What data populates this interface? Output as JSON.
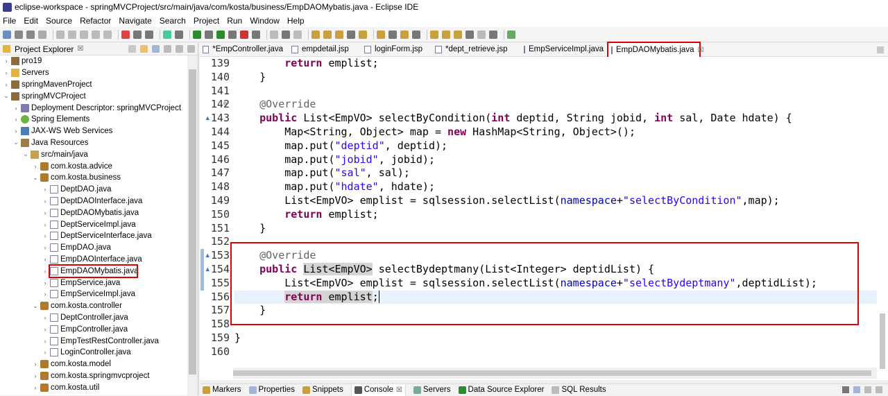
{
  "window": {
    "title": "eclipse-workspace - springMVCProject/src/main/java/com/kosta/business/EmpDAOMybatis.java - Eclipse IDE"
  },
  "menu": [
    "File",
    "Edit",
    "Source",
    "Refactor",
    "Navigate",
    "Search",
    "Project",
    "Run",
    "Window",
    "Help"
  ],
  "explorer": {
    "title": "Project Explorer",
    "close_glyph": "☒",
    "tree": [
      {
        "label": "pro19",
        "indent": 0,
        "chev": "›",
        "icon": "project"
      },
      {
        "label": "Servers",
        "indent": 0,
        "chev": "›",
        "icon": "folder"
      },
      {
        "label": "springMavenProject",
        "indent": 0,
        "chev": "›",
        "icon": "project"
      },
      {
        "label": "springMVCProject",
        "indent": 0,
        "chev": "⌄",
        "icon": "project"
      },
      {
        "label": "Deployment Descriptor: springMVCProject",
        "indent": 1,
        "chev": "›",
        "icon": "desc"
      },
      {
        "label": "Spring Elements",
        "indent": 1,
        "chev": "›",
        "icon": "spring"
      },
      {
        "label": "JAX-WS Web Services",
        "indent": 1,
        "chev": "›",
        "icon": "ws"
      },
      {
        "label": "Java Resources",
        "indent": 1,
        "chev": "⌄",
        "icon": "jres"
      },
      {
        "label": "src/main/java",
        "indent": 2,
        "chev": "⌄",
        "icon": "src"
      },
      {
        "label": "com.kosta.advice",
        "indent": 3,
        "chev": "›",
        "icon": "pkg"
      },
      {
        "label": "com.kosta.business",
        "indent": 3,
        "chev": "⌄",
        "icon": "pkg"
      },
      {
        "label": "DeptDAO.java",
        "indent": 4,
        "chev": "›",
        "icon": "jfile"
      },
      {
        "label": "DeptDAOInterface.java",
        "indent": 4,
        "chev": "›",
        "icon": "jfile"
      },
      {
        "label": "DeptDAOMybatis.java",
        "indent": 4,
        "chev": "›",
        "icon": "jfile"
      },
      {
        "label": "DeptServiceImpl.java",
        "indent": 4,
        "chev": "›",
        "icon": "jfile"
      },
      {
        "label": "DeptServiceInterface.java",
        "indent": 4,
        "chev": "›",
        "icon": "jfile"
      },
      {
        "label": "EmpDAO.java",
        "indent": 4,
        "chev": "›",
        "icon": "jfile"
      },
      {
        "label": "EmpDAOInterface.java",
        "indent": 4,
        "chev": "›",
        "icon": "jfile"
      },
      {
        "label": "EmpDAOMybatis.java",
        "indent": 4,
        "chev": "›",
        "icon": "jfile"
      },
      {
        "label": "EmpService.java",
        "indent": 4,
        "chev": "›",
        "icon": "jfile"
      },
      {
        "label": "EmpServiceImpl.java",
        "indent": 4,
        "chev": "›",
        "icon": "jfile"
      },
      {
        "label": "com.kosta.controller",
        "indent": 3,
        "chev": "⌄",
        "icon": "pkg"
      },
      {
        "label": "DeptController.java",
        "indent": 4,
        "chev": "›",
        "icon": "jfile"
      },
      {
        "label": "EmpController.java",
        "indent": 4,
        "chev": "›",
        "icon": "jfile"
      },
      {
        "label": "EmpTestRestController.java",
        "indent": 4,
        "chev": "›",
        "icon": "jfile"
      },
      {
        "label": "LoginController.java",
        "indent": 4,
        "chev": "›",
        "icon": "jfile"
      },
      {
        "label": "com.kosta.model",
        "indent": 3,
        "chev": "›",
        "icon": "pkg"
      },
      {
        "label": "com.kosta.springmvcproject",
        "indent": 3,
        "chev": "›",
        "icon": "pkg"
      },
      {
        "label": "com.kosta.util",
        "indent": 3,
        "chev": "›",
        "icon": "pkg"
      }
    ]
  },
  "editor_tabs": [
    {
      "label": "*EmpController.java",
      "active": false
    },
    {
      "label": "empdetail.jsp",
      "active": false
    },
    {
      "label": "loginForm.jsp",
      "active": false
    },
    {
      "label": "*dept_retrieve.jsp",
      "active": false
    },
    {
      "label": "EmpServiceImpl.java",
      "active": false
    },
    {
      "label": "EmpDAOMybatis.java",
      "active": true
    }
  ],
  "tab_close_glyph": "☒",
  "code": {
    "line_numbers": [
      "139",
      "140",
      "141",
      "142",
      "143",
      "144",
      "145",
      "146",
      "147",
      "148",
      "149",
      "150",
      "151",
      "152",
      "153",
      "154",
      "155",
      "156",
      "157",
      "158",
      "159",
      "160"
    ],
    "lines": [
      "        return emplist;",
      "    }",
      "",
      "    @Override",
      "    public List<EmpVO> selectByCondition(int deptid, String jobid, int sal, Date hdate) {",
      "        Map<String, Object> map = new HashMap<String, Object>();",
      "        map.put(\"deptid\", deptid);",
      "        map.put(\"jobid\", jobid);",
      "        map.put(\"sal\", sal);",
      "        map.put(\"hdate\", hdate);",
      "        List<EmpVO> emplist = sqlsession.selectList(namespace+\"selectByCondition\",map);",
      "        return emplist;",
      "    }",
      "",
      "    @Override",
      "    public List<EmpVO> selectBydeptmany(List<Integer> deptidList) {",
      "        List<EmpVO> emplist = sqlsession.selectList(namespace+\"selectBydeptmany\",deptidList);",
      "        return emplist;",
      "    }",
      "",
      "}",
      ""
    ]
  },
  "bottom_tabs": [
    {
      "label": "Markers",
      "active": false
    },
    {
      "label": "Properties",
      "active": false
    },
    {
      "label": "Snippets",
      "active": false
    },
    {
      "label": "Console",
      "active": true
    },
    {
      "label": "Servers",
      "active": false
    },
    {
      "label": "Data Source Explorer",
      "active": false
    },
    {
      "label": "SQL Results",
      "active": false
    }
  ]
}
